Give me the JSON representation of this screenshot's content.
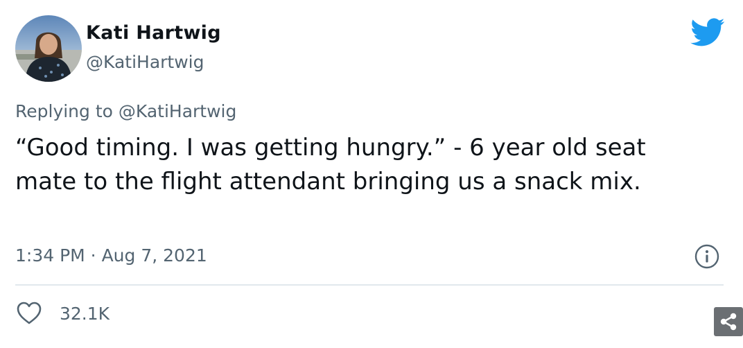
{
  "author": {
    "display_name": "Kati Hartwig",
    "handle": "@KatiHartwig"
  },
  "reply": {
    "prefix": "Replying to ",
    "handle": "@KatiHartwig"
  },
  "tweet": {
    "text": "“Good timing. I was getting hungry.” - 6 year old seat mate to the flight attendant bringing us a snack mix.",
    "timestamp": "1:34 PM · Aug 7, 2021"
  },
  "engagement": {
    "likes": "32.1K"
  },
  "icons": {
    "brand": "twitter-bird-icon",
    "info": "info-icon",
    "like": "heart-icon",
    "share": "share-icon"
  },
  "colors": {
    "twitter_blue": "#1d9bf0",
    "secondary_text": "#536471",
    "primary_text": "#0f1419",
    "divider": "#e1e8ed",
    "share_button_bg": "#6b6f73"
  }
}
